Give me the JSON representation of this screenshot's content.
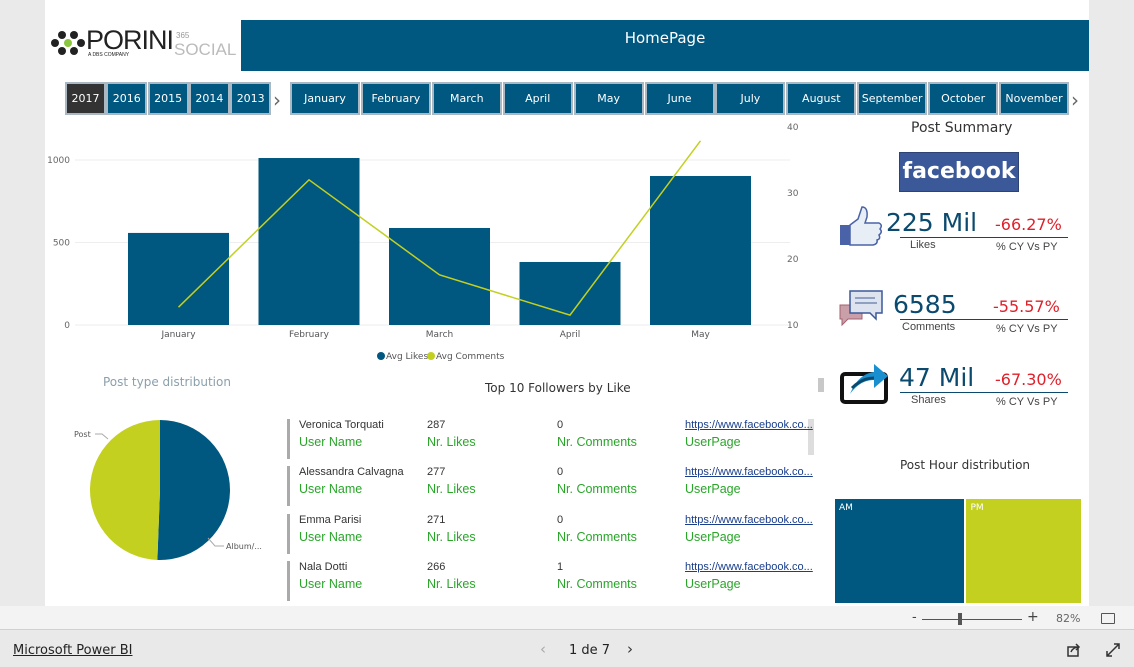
{
  "header": {
    "logo_brand": "PORINI",
    "logo_tagline": "A DBS COMPANY",
    "logo_sup": "365",
    "logo_social": "SOCIAL",
    "title": "HomePage"
  },
  "years": {
    "items": [
      "2017",
      "2016",
      "2015",
      "2014",
      "2013"
    ],
    "selected": "2017"
  },
  "months": {
    "items": [
      "January",
      "February",
      "March",
      "April",
      "May",
      "June",
      "July",
      "August",
      "September",
      "October",
      "November"
    ]
  },
  "colors": {
    "primary": "#00577f",
    "accent": "#c3d020",
    "negative": "#e0202a",
    "label_green": "#2aa52a"
  },
  "chart_data": [
    {
      "type": "bar+line",
      "categories": [
        "January",
        "February",
        "March",
        "April",
        "May"
      ],
      "series": [
        {
          "name": "Avg Likes",
          "axis": "left",
          "type": "bar",
          "values": [
            558,
            1012,
            588,
            382,
            903
          ]
        },
        {
          "name": "Avg Comments",
          "axis": "right",
          "type": "line",
          "values": [
            12.7,
            32,
            17.6,
            11.5,
            37.9
          ]
        }
      ],
      "left_ticks": [
        "0",
        "500",
        "1000"
      ],
      "right_ticks": [
        "10",
        "20",
        "30",
        "40"
      ],
      "ylim_left": [
        0,
        1000
      ],
      "ylim_right": [
        10,
        40
      ],
      "legend": "bottom",
      "grid": true
    },
    {
      "type": "pie",
      "title": "Post type distribution",
      "labels": [
        "Post",
        "Album/..."
      ],
      "values": [
        49.4,
        50.6
      ]
    },
    {
      "type": "treemap",
      "title": "Post Hour distribution",
      "labels": [
        "AM",
        "PM"
      ],
      "values": [
        53,
        47
      ]
    }
  ],
  "summary": {
    "title": "Post Summary",
    "brand": "facebook",
    "kpis": [
      {
        "icon": "thumbs-up-icon",
        "value": "225 Mil",
        "label": "Likes",
        "pct": "-66.27%",
        "pct_label": "% CY Vs PY"
      },
      {
        "icon": "comments-icon",
        "value": "6585",
        "label": "Comments",
        "pct": "-55.57%",
        "pct_label": "% CY Vs PY"
      },
      {
        "icon": "share-icon",
        "value": "47 Mil",
        "label": "Shares",
        "pct": "-67.30%",
        "pct_label": "% CY Vs PY"
      }
    ]
  },
  "followers": {
    "title": "Top 10 Followers by Like",
    "labels": {
      "name": "User Name",
      "likes": "Nr. Likes",
      "comments": "Nr. Comments",
      "page": "UserPage"
    },
    "rows": [
      {
        "name": "Veronica Torquati",
        "likes": "287",
        "comments": "0",
        "url": "https://www.facebook.co..."
      },
      {
        "name": "Alessandra Calvagna",
        "likes": "277",
        "comments": "0",
        "url": "https://www.facebook.co..."
      },
      {
        "name": "Emma Parisi",
        "likes": "271",
        "comments": "0",
        "url": "https://www.facebook.co..."
      },
      {
        "name": "Nala Dotti",
        "likes": "266",
        "comments": "1",
        "url": "https://www.facebook.co..."
      }
    ]
  },
  "zoombar": {
    "minus": "-",
    "plus": "+",
    "zoom": "82%",
    "zoom_level": 82
  },
  "footer": {
    "brand": "Microsoft Power BI",
    "page": "1 de 7"
  }
}
